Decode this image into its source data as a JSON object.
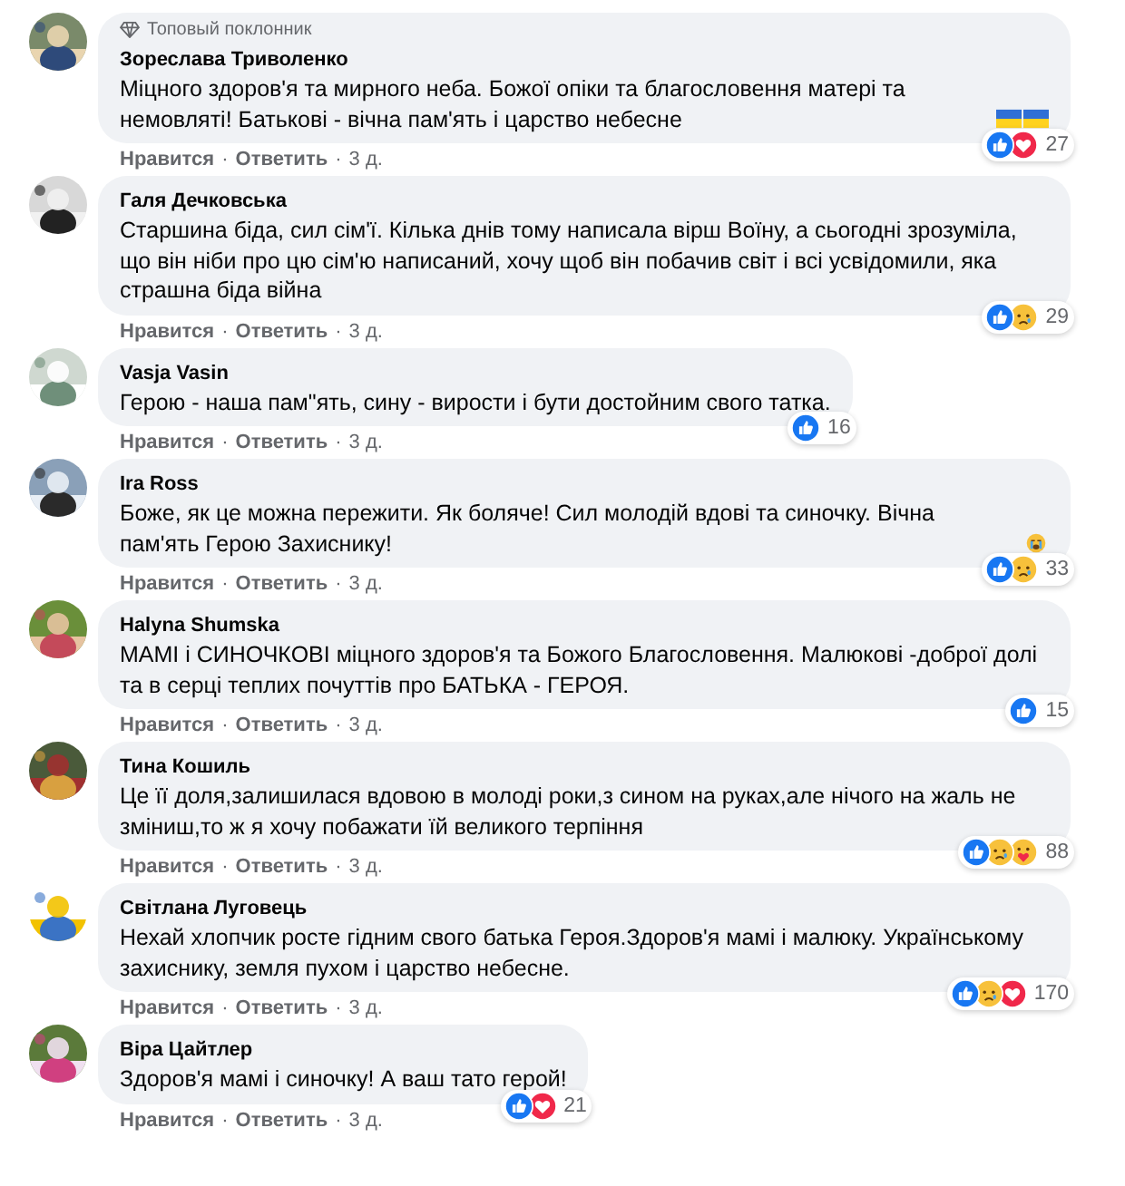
{
  "comments": [
    {
      "author": "Зореслава Триволенко",
      "badge": "Топовый поклонник",
      "text": "Міцного здоров'я та мирного неба. Божої опіки та благословення матері та немовляті! Батькові - вічна пам'ять і царство небесне",
      "trailing_emoji": [
        {
          "kind": "flag"
        },
        {
          "kind": "flag"
        }
      ],
      "reactions": [
        {
          "kind": "like"
        },
        {
          "kind": "love"
        }
      ],
      "reaction_count": "27",
      "actions": {
        "like": "Нравится",
        "sep1": "·",
        "reply": "Ответить",
        "sep2": "·",
        "time": "3 д."
      }
    },
    {
      "author": "Галя Дечковська",
      "text": "Старшина біда, сил сім'ї. Кілька днів тому написала вірш Воїну, а сьогодні зрозуміла, що він ніби про цю сім'ю написаний, хочу щоб він побачив світ і всі усвідомили, яка страшна біда війна",
      "reactions": [
        {
          "kind": "like"
        },
        {
          "kind": "sad"
        }
      ],
      "reaction_count": "29",
      "actions": {
        "like": "Нравится",
        "sep1": "·",
        "reply": "Ответить",
        "sep2": "·",
        "time": "3 д."
      }
    },
    {
      "author": "Vasja Vasin",
      "text": "Герою - наша пам\"ять, сину - вирости і бути достойним свого татка.",
      "reactions": [
        {
          "kind": "like"
        }
      ],
      "reaction_count": "16",
      "actions": {
        "like": "Нравится",
        "sep1": "·",
        "reply": "Ответить",
        "sep2": "·",
        "time": "3 д."
      }
    },
    {
      "author": "Ira Ross",
      "text": "Боже, як це можна пережити. Як боляче! Сил молодій вдові та синочку. Вічна пам'ять Герою Захиснику!",
      "trailing_emoji": [
        {
          "kind": "crying"
        }
      ],
      "reactions": [
        {
          "kind": "like"
        },
        {
          "kind": "sad"
        }
      ],
      "reaction_count": "33",
      "actions": {
        "like": "Нравится",
        "sep1": "·",
        "reply": "Ответить",
        "sep2": "·",
        "time": "3 д."
      }
    },
    {
      "author": "Halyna Shumska",
      "text": "МАМІ і СИНОЧКОВІ міцного здоров'я та Божого Благословення. Малюкові -доброї долі та в серці теплих почуттів про БАТЬКА - ГЕРОЯ.",
      "reactions": [
        {
          "kind": "like"
        }
      ],
      "reaction_count": "15",
      "actions": {
        "like": "Нравится",
        "sep1": "·",
        "reply": "Ответить",
        "sep2": "·",
        "time": "3 д."
      }
    },
    {
      "author": "Тина Кошиль",
      "text": "Це її доля,залишилася вдовою в молоді роки,з сином на руках,але нічого на жаль не зміниш,то ж я хочу побажати їй великого терпіння",
      "reactions": [
        {
          "kind": "like"
        },
        {
          "kind": "sad"
        },
        {
          "kind": "care"
        }
      ],
      "reaction_count": "88",
      "actions": {
        "like": "Нравится",
        "sep1": "·",
        "reply": "Ответить",
        "sep2": "·",
        "time": "3 д."
      }
    },
    {
      "author": "Світлана Луговець",
      "text": "Нехай хлопчик росте гідним свого батька Героя.Здоров'я мамі і малюку. Українському захиснику, земля пухом і царство небесне.",
      "reactions": [
        {
          "kind": "like"
        },
        {
          "kind": "sad"
        },
        {
          "kind": "love"
        }
      ],
      "reaction_count": "170",
      "actions": {
        "like": "Нравится",
        "sep1": "·",
        "reply": "Ответить",
        "sep2": "·",
        "time": "3 д."
      }
    },
    {
      "author": "Віра Цайтлер",
      "text": "Здоров'я мамі і синочку! А ваш тато герой!",
      "reactions": [
        {
          "kind": "like"
        },
        {
          "kind": "love"
        }
      ],
      "reaction_count": "21",
      "actions": {
        "like": "Нравится",
        "sep1": "·",
        "reply": "Ответить",
        "sep2": "·",
        "time": "3 д."
      }
    }
  ]
}
